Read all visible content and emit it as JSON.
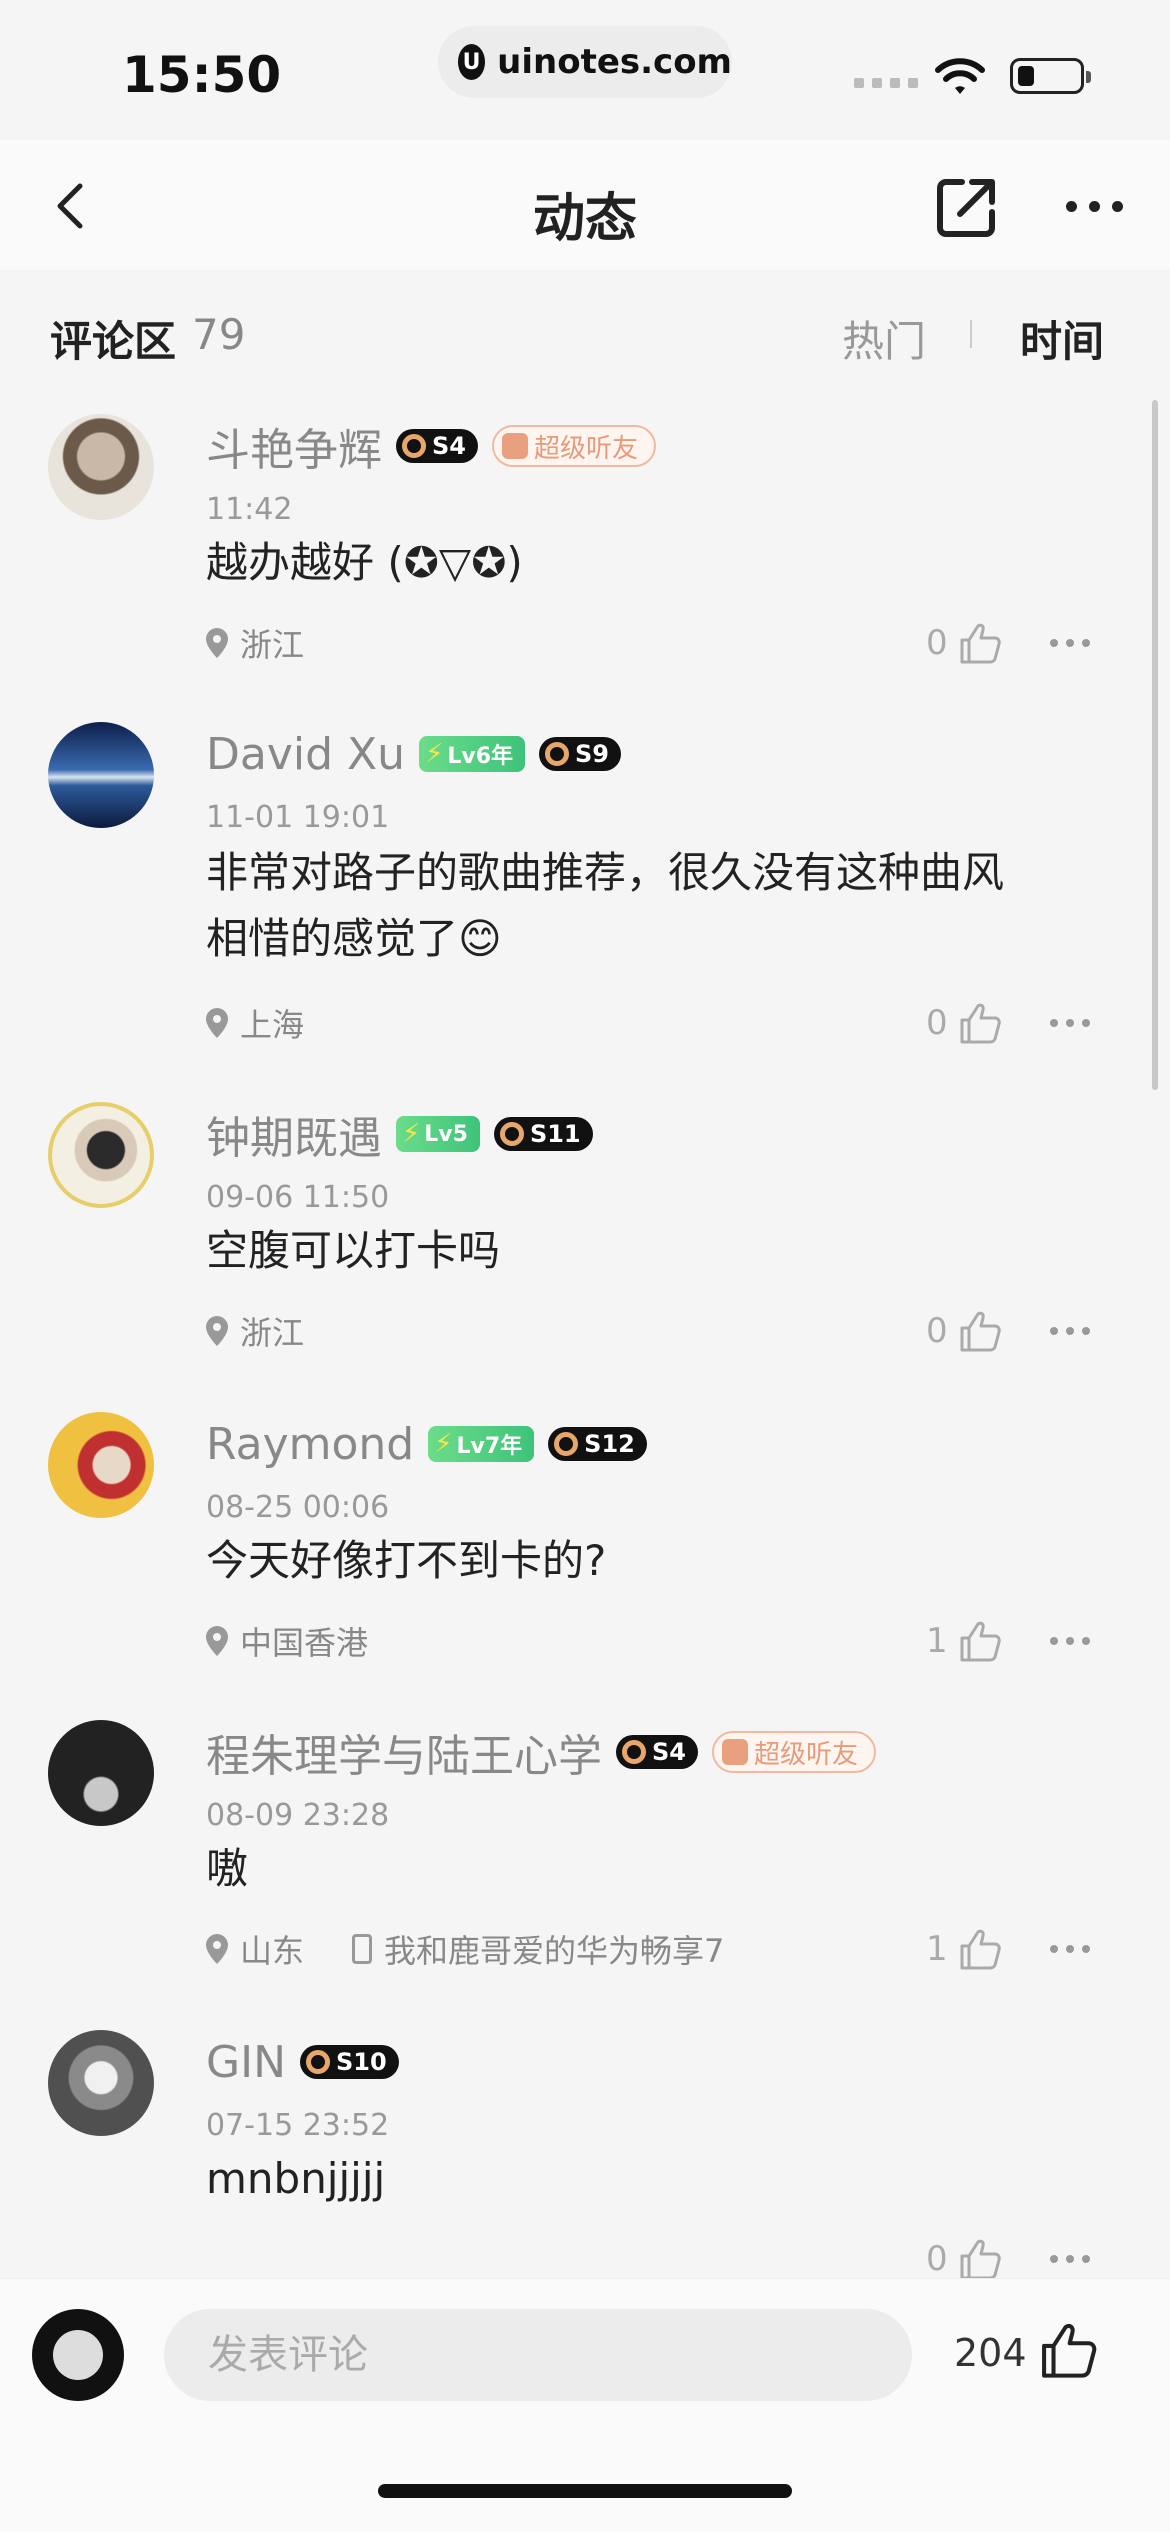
{
  "status_bar": {
    "time": "15:50",
    "url": "uinotes.com",
    "url_logo": "U"
  },
  "nav": {
    "title": "动态"
  },
  "comment_header": {
    "title": "评论区",
    "count": "79",
    "sort_hot": "热门",
    "sort_time": "时间"
  },
  "comments": [
    {
      "username": "斗艳争辉",
      "time": "11:42",
      "text": "越办越好 (✪▽✪)",
      "location": "浙江",
      "likes": "0",
      "badges": {
        "s": "S4",
        "super": "超级听友"
      }
    },
    {
      "username": "David Xu",
      "time": "11-01 19:01",
      "text_line1": "非常对路子的歌曲推荐，很久没有这种曲风",
      "text_line2": "相惜的感觉了😊",
      "location": "上海",
      "likes": "0",
      "badges": {
        "lv": "Lv6年",
        "s": "S9"
      }
    },
    {
      "username": "钟期既遇",
      "time": "09-06 11:50",
      "text": "空腹可以打卡吗",
      "location": "浙江",
      "likes": "0",
      "badges": {
        "lv": "Lv5",
        "s": "S11"
      }
    },
    {
      "username": "Raymond",
      "time": "08-25 00:06",
      "text": "今天好像打不到卡的?",
      "location": "中国香港",
      "likes": "1",
      "badges": {
        "lv": "Lv7年",
        "s": "S12"
      }
    },
    {
      "username": "程朱理学与陆王心学",
      "time": "08-09 23:28",
      "text": "嗷",
      "location": "山东",
      "device": "我和鹿哥爱的华为畅享7",
      "likes": "1",
      "badges": {
        "s": "S4",
        "super": "超级听友"
      }
    },
    {
      "username": "GIN",
      "time": "07-15 23:52",
      "text": "mnbnjjjjj",
      "likes": "0",
      "badges": {
        "s": "S10"
      }
    }
  ],
  "composer": {
    "placeholder": "发表评论",
    "like_count": "204"
  },
  "icons": {
    "back": "chevron-left-icon",
    "share": "share-icon",
    "more": "more-icon",
    "location": "location-pin-icon",
    "like": "thumb-up-icon",
    "device": "phone-icon"
  },
  "colors": {
    "background": "#f5f5f5",
    "lv_badge": "#3ec37a",
    "super_badge": "#e69b7a",
    "s_badge_ring": "#e8a76a"
  }
}
